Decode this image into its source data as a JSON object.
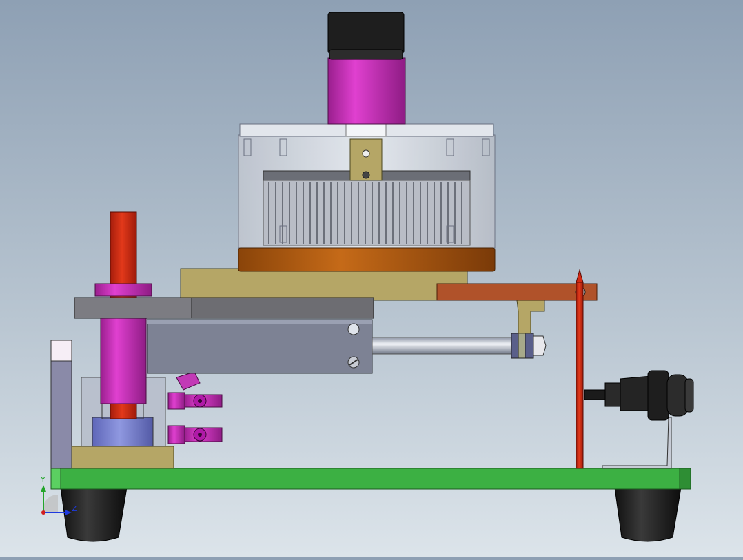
{
  "viewport": {
    "background_top": "#8ea0b4",
    "background_bottom": "#dce4ea"
  },
  "model": {
    "parts": [
      "base-plate",
      "rubber-feet",
      "motor-heatsink-assembly",
      "pneumatic-cylinder",
      "guide-post",
      "fittings",
      "sensor-bracket",
      "connector",
      "pointer-rod"
    ],
    "colors": {
      "base_plate": "#3cb043",
      "feet": "#1c1c1c",
      "motor_cap": "#1e1e1e",
      "motor_body": "#c02fb2",
      "heatsink_glass": "#d4d9e0",
      "heatsink_ring": "#a35a12",
      "mount_plate": "#b5a666",
      "cylinder_body": "#7d8294",
      "arm": "#b0522a",
      "pointer_rod": "#d42a14",
      "guide_post": "#c72f14",
      "fitting": "#d01ec8"
    }
  },
  "triad": {
    "x_label": "Z",
    "y_label": "Y",
    "x_color": "#1e3adf",
    "y_color": "#23a52a",
    "origin_color": "#d21f1f"
  }
}
